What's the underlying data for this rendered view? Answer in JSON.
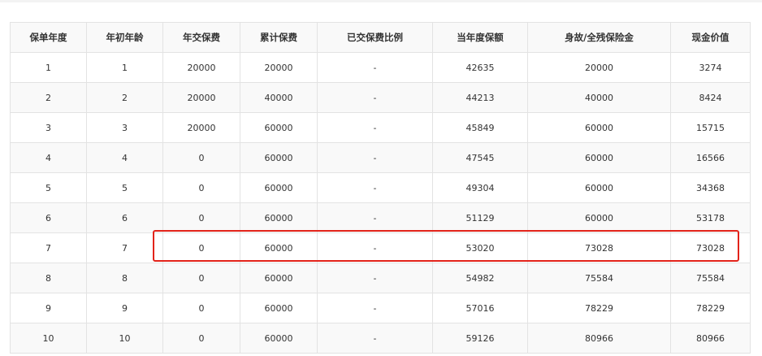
{
  "table": {
    "headers": [
      "保单年度",
      "年初年龄",
      "年交保费",
      "累计保费",
      "已交保费比例",
      "当年度保额",
      "身故/全残保险金",
      "现金价值"
    ],
    "rows": [
      [
        "1",
        "1",
        "20000",
        "20000",
        "-",
        "42635",
        "20000",
        "3274"
      ],
      [
        "2",
        "2",
        "20000",
        "40000",
        "-",
        "44213",
        "40000",
        "8424"
      ],
      [
        "3",
        "3",
        "20000",
        "60000",
        "-",
        "45849",
        "60000",
        "15715"
      ],
      [
        "4",
        "4",
        "0",
        "60000",
        "-",
        "47545",
        "60000",
        "16566"
      ],
      [
        "5",
        "5",
        "0",
        "60000",
        "-",
        "49304",
        "60000",
        "34368"
      ],
      [
        "6",
        "6",
        "0",
        "60000",
        "-",
        "51129",
        "60000",
        "53178"
      ],
      [
        "7",
        "7",
        "0",
        "60000",
        "-",
        "53020",
        "73028",
        "73028"
      ],
      [
        "8",
        "8",
        "0",
        "60000",
        "-",
        "54982",
        "75584",
        "75584"
      ],
      [
        "9",
        "9",
        "0",
        "60000",
        "-",
        "57016",
        "78229",
        "78229"
      ],
      [
        "10",
        "10",
        "0",
        "60000",
        "-",
        "59126",
        "80966",
        "80966"
      ]
    ]
  },
  "highlight": {
    "row_index": 6,
    "color": "#e2231a"
  }
}
